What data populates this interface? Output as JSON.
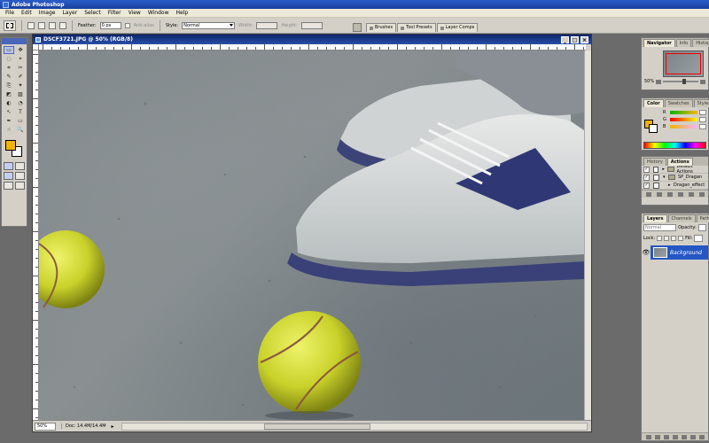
{
  "app": {
    "title": "Adobe Photoshop"
  },
  "menubar": {
    "items": [
      "File",
      "Edit",
      "Image",
      "Layer",
      "Select",
      "Filter",
      "View",
      "Window",
      "Help"
    ]
  },
  "options": {
    "feather_label": "Feather:",
    "feather_value": "0 px",
    "antialias_label": "Anti-alias",
    "style_label": "Style:",
    "style_value": "Normal",
    "width_label": "Width:",
    "height_label": "Height:"
  },
  "palette_well": {
    "tabs": [
      "Brushes",
      "Tool Presets",
      "Layer Comps"
    ]
  },
  "toolbox": {
    "tools": [
      "▭",
      "✥",
      "◌",
      "⌖",
      "⌗",
      "✂",
      "✎",
      "✐",
      "⎘",
      "✦",
      "◩",
      "▨",
      "◐",
      "◔",
      "↖",
      "T",
      "✒",
      "▭",
      "☝",
      "🔍"
    ],
    "foreground_color": "#f4b400",
    "background_color": "#ffffff"
  },
  "document": {
    "title": "DSCF3721.JPG @ 50% (RGB/8)",
    "zoom": "50%",
    "doc_size": "Doc: 14.4M/14.4M"
  },
  "navigator": {
    "tabs": [
      "Navigator",
      "Info",
      "Histogram"
    ],
    "zoom": "50%"
  },
  "color_palette": {
    "tabs": [
      "Color",
      "Swatches",
      "Styles"
    ],
    "channels": [
      "R",
      "G",
      "B"
    ]
  },
  "history": {
    "tabs": [
      "History",
      "Actions"
    ],
    "items": [
      {
        "label": "Default Actions",
        "type": "set"
      },
      {
        "label": "SP_Dragan",
        "type": "set"
      },
      {
        "label": "Dragan_effect",
        "type": "action"
      }
    ]
  },
  "layers": {
    "tabs": [
      "Layers",
      "Channels",
      "Paths"
    ],
    "blend_mode": "Normal",
    "opacity_label": "Opacity:",
    "lock_label": "Lock:",
    "fill_label": "Fill:",
    "layer_name": "Background"
  }
}
